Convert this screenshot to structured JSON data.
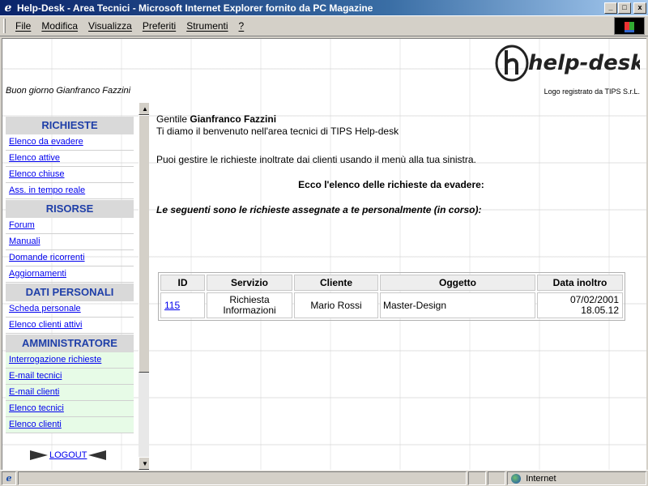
{
  "window": {
    "title": "Help-Desk - Area Tecnici - Microsoft Internet Explorer fornito da PC Magazine",
    "icon": "ie-icon",
    "controls": [
      "_",
      "□",
      "x"
    ]
  },
  "menubar": {
    "items": [
      "File",
      "Modifica",
      "Visualizza",
      "Preferiti",
      "Strumenti",
      "?"
    ]
  },
  "header": {
    "greeting": "Buon giorno Gianfranco Fazzini",
    "logo_text": "help-desk",
    "logo_caption": "Logo registrato da TIPS S.r.L."
  },
  "sidebar": {
    "sections": [
      {
        "title": "RICHIESTE",
        "items": [
          "Elenco da evadere",
          "Elenco attive",
          "Elenco chiuse",
          "Ass. in tempo reale"
        ]
      },
      {
        "title": "RISORSE",
        "items": [
          "Forum",
          "Manuali",
          "Domande ricorrenti",
          "Aggiornamenti"
        ]
      },
      {
        "title": "DATI PERSONALI",
        "items": [
          "Scheda personale",
          "Elenco clienti attivi"
        ]
      },
      {
        "title": "AMMINISTRATORE",
        "items": [
          "Interrogazione richieste",
          "E-mail tecnici",
          "E-mail clienti",
          "Elenco tecnici",
          "Elenco clienti"
        ]
      }
    ],
    "logout": "LOGOUT"
  },
  "main": {
    "salutation_prefix": "Gentile",
    "user_name": "Gianfranco Fazzini",
    "welcome": "Ti diamo il benvenuto nell'area tecnici di TIPS Help-desk",
    "instructions": "Puoi gestire le richieste inoltrate dai clienti usando il menù alla tua sinistra.",
    "list_title": "Ecco l'elenco delle richieste da evadere:",
    "assigned_text": "Le seguenti sono le richieste assegnate a te personalmente (in corso):",
    "table": {
      "headers": [
        "ID",
        "Servizio",
        "Cliente",
        "Oggetto",
        "Data inoltro"
      ],
      "rows": [
        {
          "id": "115",
          "servizio_1": "Richiesta",
          "servizio_2": "Informazioni",
          "cliente": "Mario Rossi",
          "oggetto": "Master-Design",
          "data": "07/02/2001",
          "ora": "18.05.12"
        }
      ]
    }
  },
  "statusbar": {
    "zone": "Internet"
  }
}
